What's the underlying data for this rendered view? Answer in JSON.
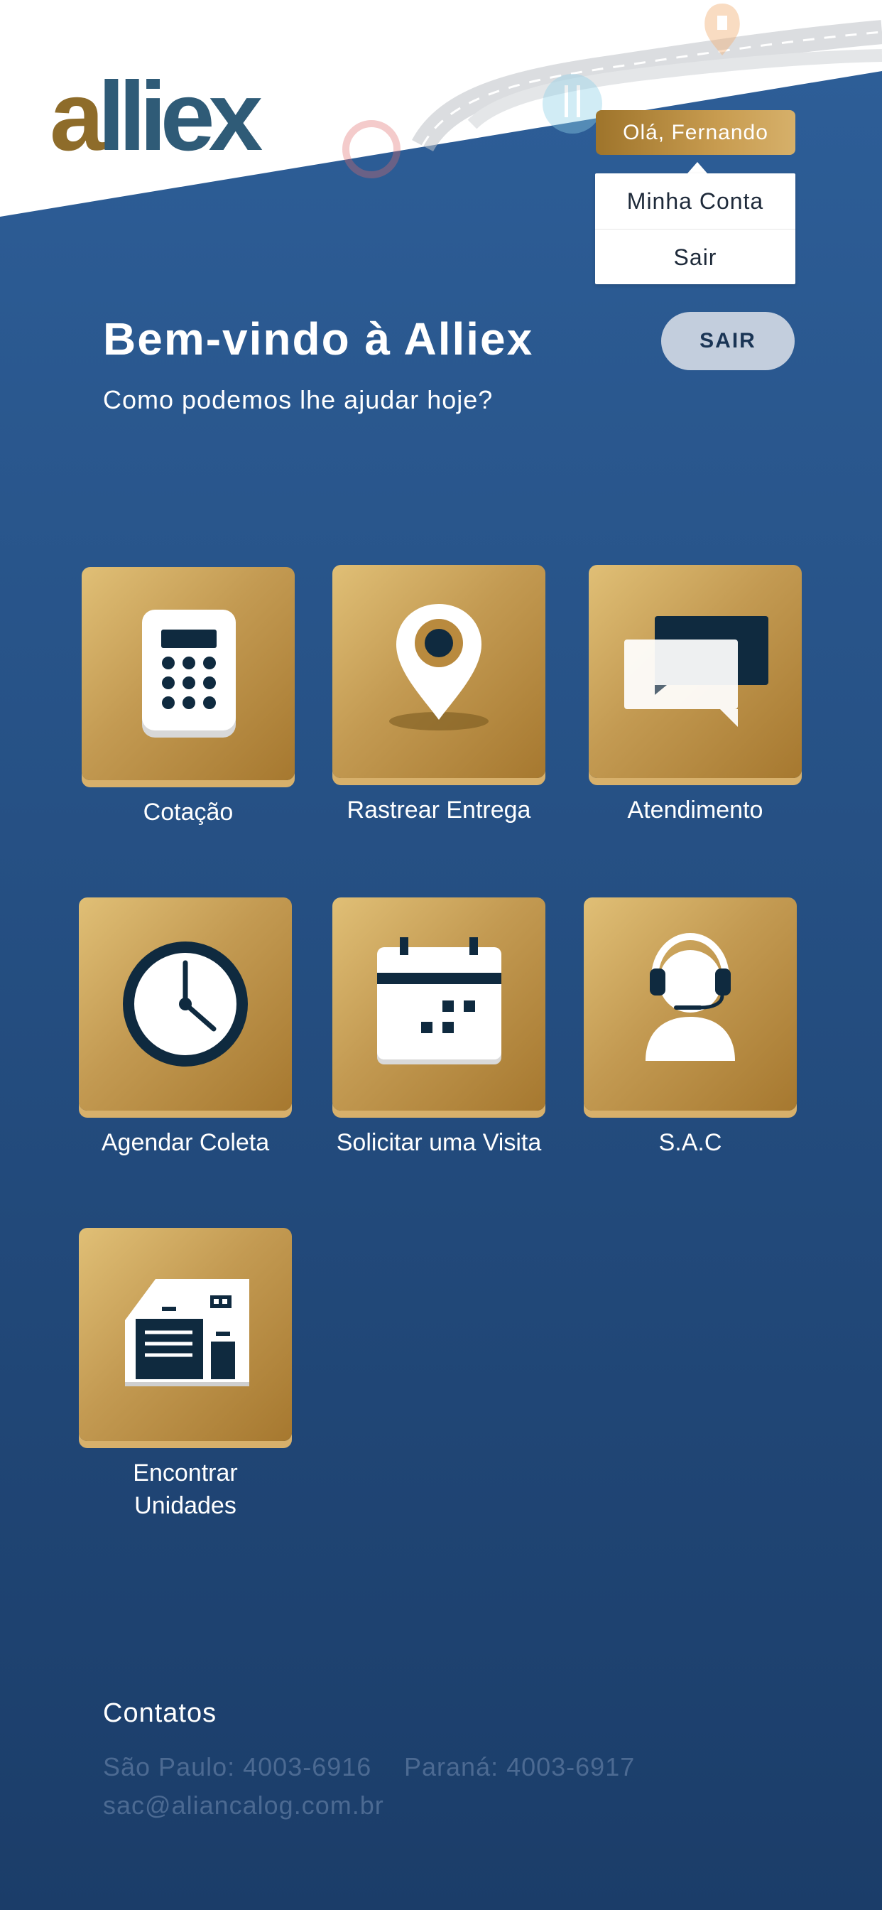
{
  "brand": {
    "logo_first": "a",
    "logo_rest": "lliex"
  },
  "header": {
    "greeting": "Olá, Fernando",
    "menu": {
      "items": [
        {
          "label": "Minha Conta"
        },
        {
          "label": "Sair"
        }
      ]
    }
  },
  "hero": {
    "title": "Bem-vindo à Alliex",
    "subtitle": "Como podemos lhe ajudar hoje?",
    "logout_label": "SAIR"
  },
  "tiles": [
    {
      "label": "Cotação",
      "icon": "calculator-icon"
    },
    {
      "label": "Rastrear Entrega",
      "icon": "map-pin-icon"
    },
    {
      "label": "Atendimento",
      "icon": "chat-bubbles-icon"
    },
    {
      "label": "Agendar Coleta",
      "icon": "clock-icon"
    },
    {
      "label": "Solicitar uma Visita",
      "icon": "calendar-icon"
    },
    {
      "label": "S.A.C",
      "icon": "headset-agent-icon"
    },
    {
      "label": "Encontrar Unidades",
      "icon": "building-icon"
    }
  ],
  "contacts": {
    "title": "Contatos",
    "sao_paulo": "São Paulo: 4003-6916",
    "parana": "Paraná: 4003-6917",
    "email": "sac@aliancalog.com.br"
  },
  "colors": {
    "background_top": "#2e5f99",
    "background_bottom": "#1b3d69",
    "gold": "#c39a52",
    "icon_dark": "#0f2a3f"
  }
}
